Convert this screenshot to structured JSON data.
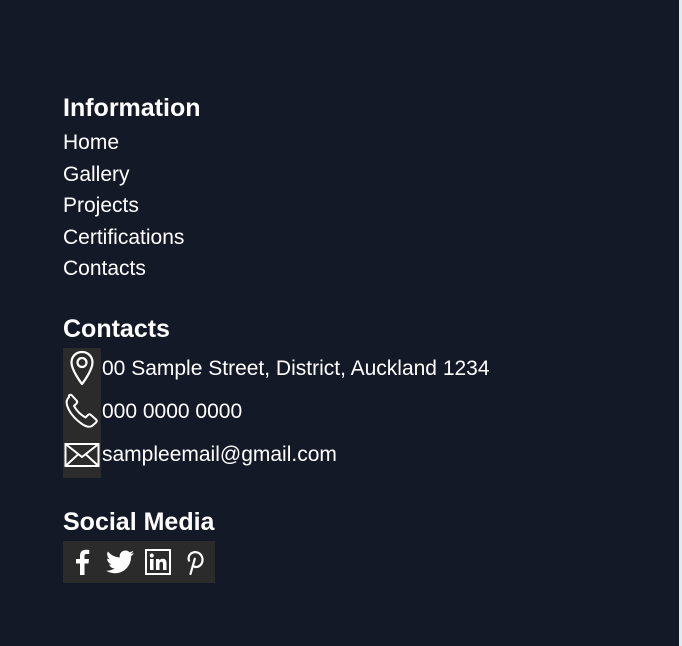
{
  "information": {
    "heading": "Information",
    "links": [
      {
        "label": "Home"
      },
      {
        "label": "Gallery"
      },
      {
        "label": "Projects"
      },
      {
        "label": "Certifications"
      },
      {
        "label": "Contacts"
      }
    ]
  },
  "contacts": {
    "heading": "Contacts",
    "items": [
      {
        "icon": "location-pin-icon",
        "text": "00 Sample Street, District, Auckland 1234"
      },
      {
        "icon": "phone-icon",
        "text": "000 0000 0000"
      },
      {
        "icon": "envelope-icon",
        "text": "sampleemail@gmail.com"
      }
    ]
  },
  "social": {
    "heading": "Social Media",
    "icons": [
      "facebook-icon",
      "twitter-icon",
      "linkedin-icon",
      "pinterest-icon"
    ]
  },
  "colors": {
    "background": "#141928",
    "text": "#ffffff",
    "icon_box": "#2b2b2b"
  }
}
